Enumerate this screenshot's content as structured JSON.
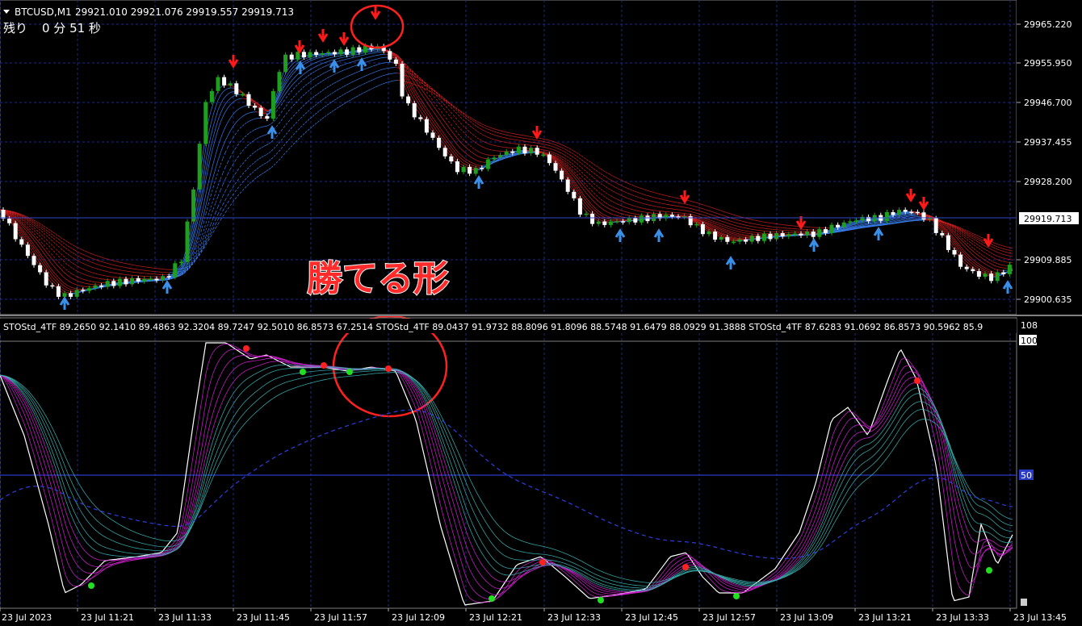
{
  "header": {
    "arrow_icon": "triangle-down-icon",
    "symbol": "BTCUSD,M1",
    "ohlc": "29921.010 29921.076 29919.557 29919.713",
    "countdown_label": "残り",
    "countdown_value": "0 分 51 秒"
  },
  "annotation": {
    "text": "勝てる形"
  },
  "price_axis": {
    "ticks": [
      "29965.220",
      "29955.950",
      "29946.700",
      "29937.455",
      "29928.200",
      "29909.885",
      "29900.635"
    ],
    "current": "29919.713"
  },
  "indicator": {
    "header_line": "STOStd_4TF 89.2650 92.1410 89.4863 92.3204 89.7247 92.5010 86.8573 67.2514  STOStd_4TF 89.0437 91.9732 88.8096 91.8096 88.5748 91.6479 88.0929 91.3888  STOStd_4TF 87.6283 91.0692 86.8573 90.5962 85.9",
    "axis_top": "108",
    "axis_100": "100",
    "axis_mid": "50"
  },
  "time_axis": {
    "labels": [
      "23 Jul 2023",
      "23 Jul 11:21",
      "23 Jul 11:33",
      "23 Jul 11:45",
      "23 Jul 11:57",
      "23 Jul 12:09",
      "23 Jul 12:21",
      "23 Jul 12:33",
      "23 Jul 12:45",
      "23 Jul 12:57",
      "23 Jul 13:09",
      "23 Jul 13:21",
      "23 Jul 13:33",
      "23 Jul 13:45"
    ]
  },
  "colors": {
    "background": "#000000",
    "grid": "#1e2a7a",
    "bull": "#1ea01e",
    "bear": "#ffffff",
    "ribbon_red": "#d42020",
    "ribbon_blue": "#3a7ff0",
    "stoch_magenta": "#d020d0",
    "stoch_teal": "#3ab0b0",
    "annotation": "#ff2a2a",
    "buy_arrow": "#3a8fe8",
    "sell_arrow": "#ff1a1a",
    "dot_green": "#20e020",
    "dot_red": "#ff2020"
  }
}
